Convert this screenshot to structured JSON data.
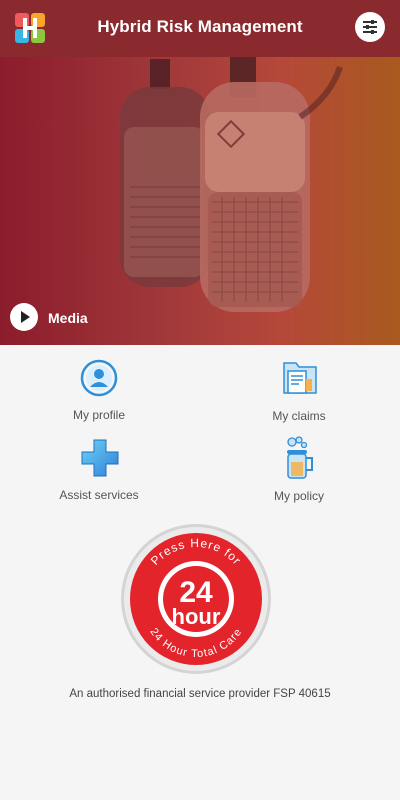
{
  "header": {
    "title": "Hybrid Risk Management",
    "logo_icon": "hrm-logo-icon",
    "menu_icon": "sliders-menu-icon"
  },
  "hero": {
    "media_label": "Media",
    "play_icon": "play-icon"
  },
  "tiles": {
    "profile": {
      "label": "My profile",
      "icon": "profile-icon"
    },
    "claims": {
      "label": "My claims",
      "icon": "claims-document-icon"
    },
    "assist": {
      "label": "Assist services",
      "icon": "plus-cross-icon"
    },
    "policy": {
      "label": "My policy",
      "icon": "policy-jar-icon"
    }
  },
  "badge": {
    "top_text": "Press Here for",
    "number": "24",
    "unit": "hour",
    "bottom_text": "24 Hour Total Care"
  },
  "footer": {
    "text": "An authorised financial service provider FSP 40615"
  },
  "colors": {
    "header_bg": "#8a2a2e",
    "badge_red": "#e3242b",
    "icon_blue": "#2f8fd8"
  }
}
